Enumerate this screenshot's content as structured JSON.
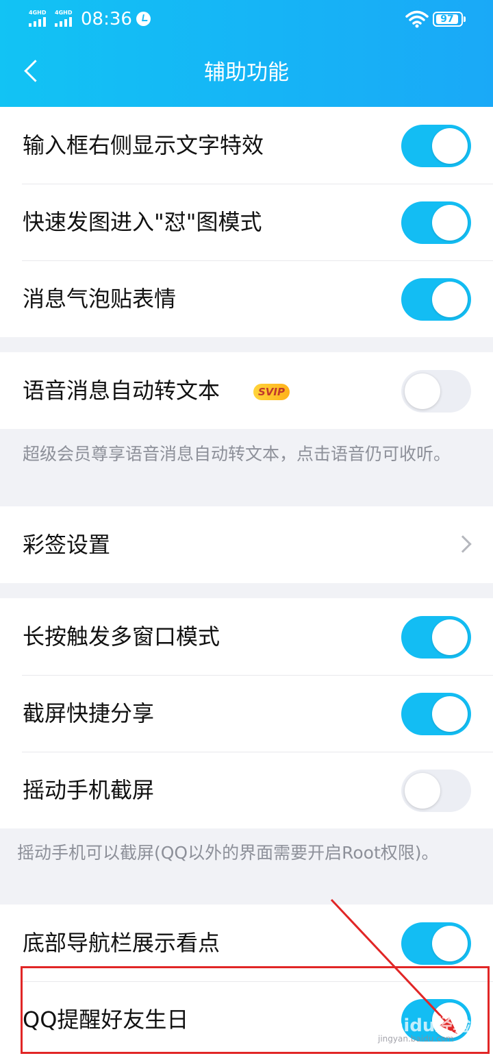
{
  "status_bar": {
    "network_1": "4GHD",
    "network_2": "4GHD",
    "time": "08:36",
    "battery": "97"
  },
  "header": {
    "title": "辅助功能",
    "back_icon": "chevron-left-icon"
  },
  "section1": [
    {
      "label": "输入框右侧显示文字特效",
      "toggle": true
    },
    {
      "label": "快速发图进入\"怼\"图模式",
      "toggle": true
    },
    {
      "label": "消息气泡贴表情",
      "toggle": true
    }
  ],
  "voice_row": {
    "label": "语音消息自动转文本",
    "badge": "SVIP",
    "toggle": false
  },
  "voice_note": "超级会员尊享语音消息自动转文本，点击语音仍可收听。",
  "caiqian_row": {
    "label": "彩签设置",
    "chevron_icon": "chevron-right-icon"
  },
  "section3": [
    {
      "label": "长按触发多窗口模式",
      "toggle": true
    },
    {
      "label": "截屏快捷分享",
      "toggle": true
    },
    {
      "label": "摇动手机截屏",
      "toggle": false
    }
  ],
  "shake_note": "摇动手机可以截屏(QQ以外的界面需要开启Root权限)。",
  "section4": [
    {
      "label": "底部导航栏展示看点",
      "toggle": true
    },
    {
      "label": "QQ提醒好友生日",
      "toggle": true
    }
  ],
  "annotation": {
    "color": "#e12626"
  },
  "watermark": {
    "brand": "Baidu经验",
    "url": "jingyan.baidu.com"
  },
  "colors": {
    "accent": "#13bdf3",
    "header_start": "#12c3f4",
    "header_end": "#1aa9f7"
  }
}
